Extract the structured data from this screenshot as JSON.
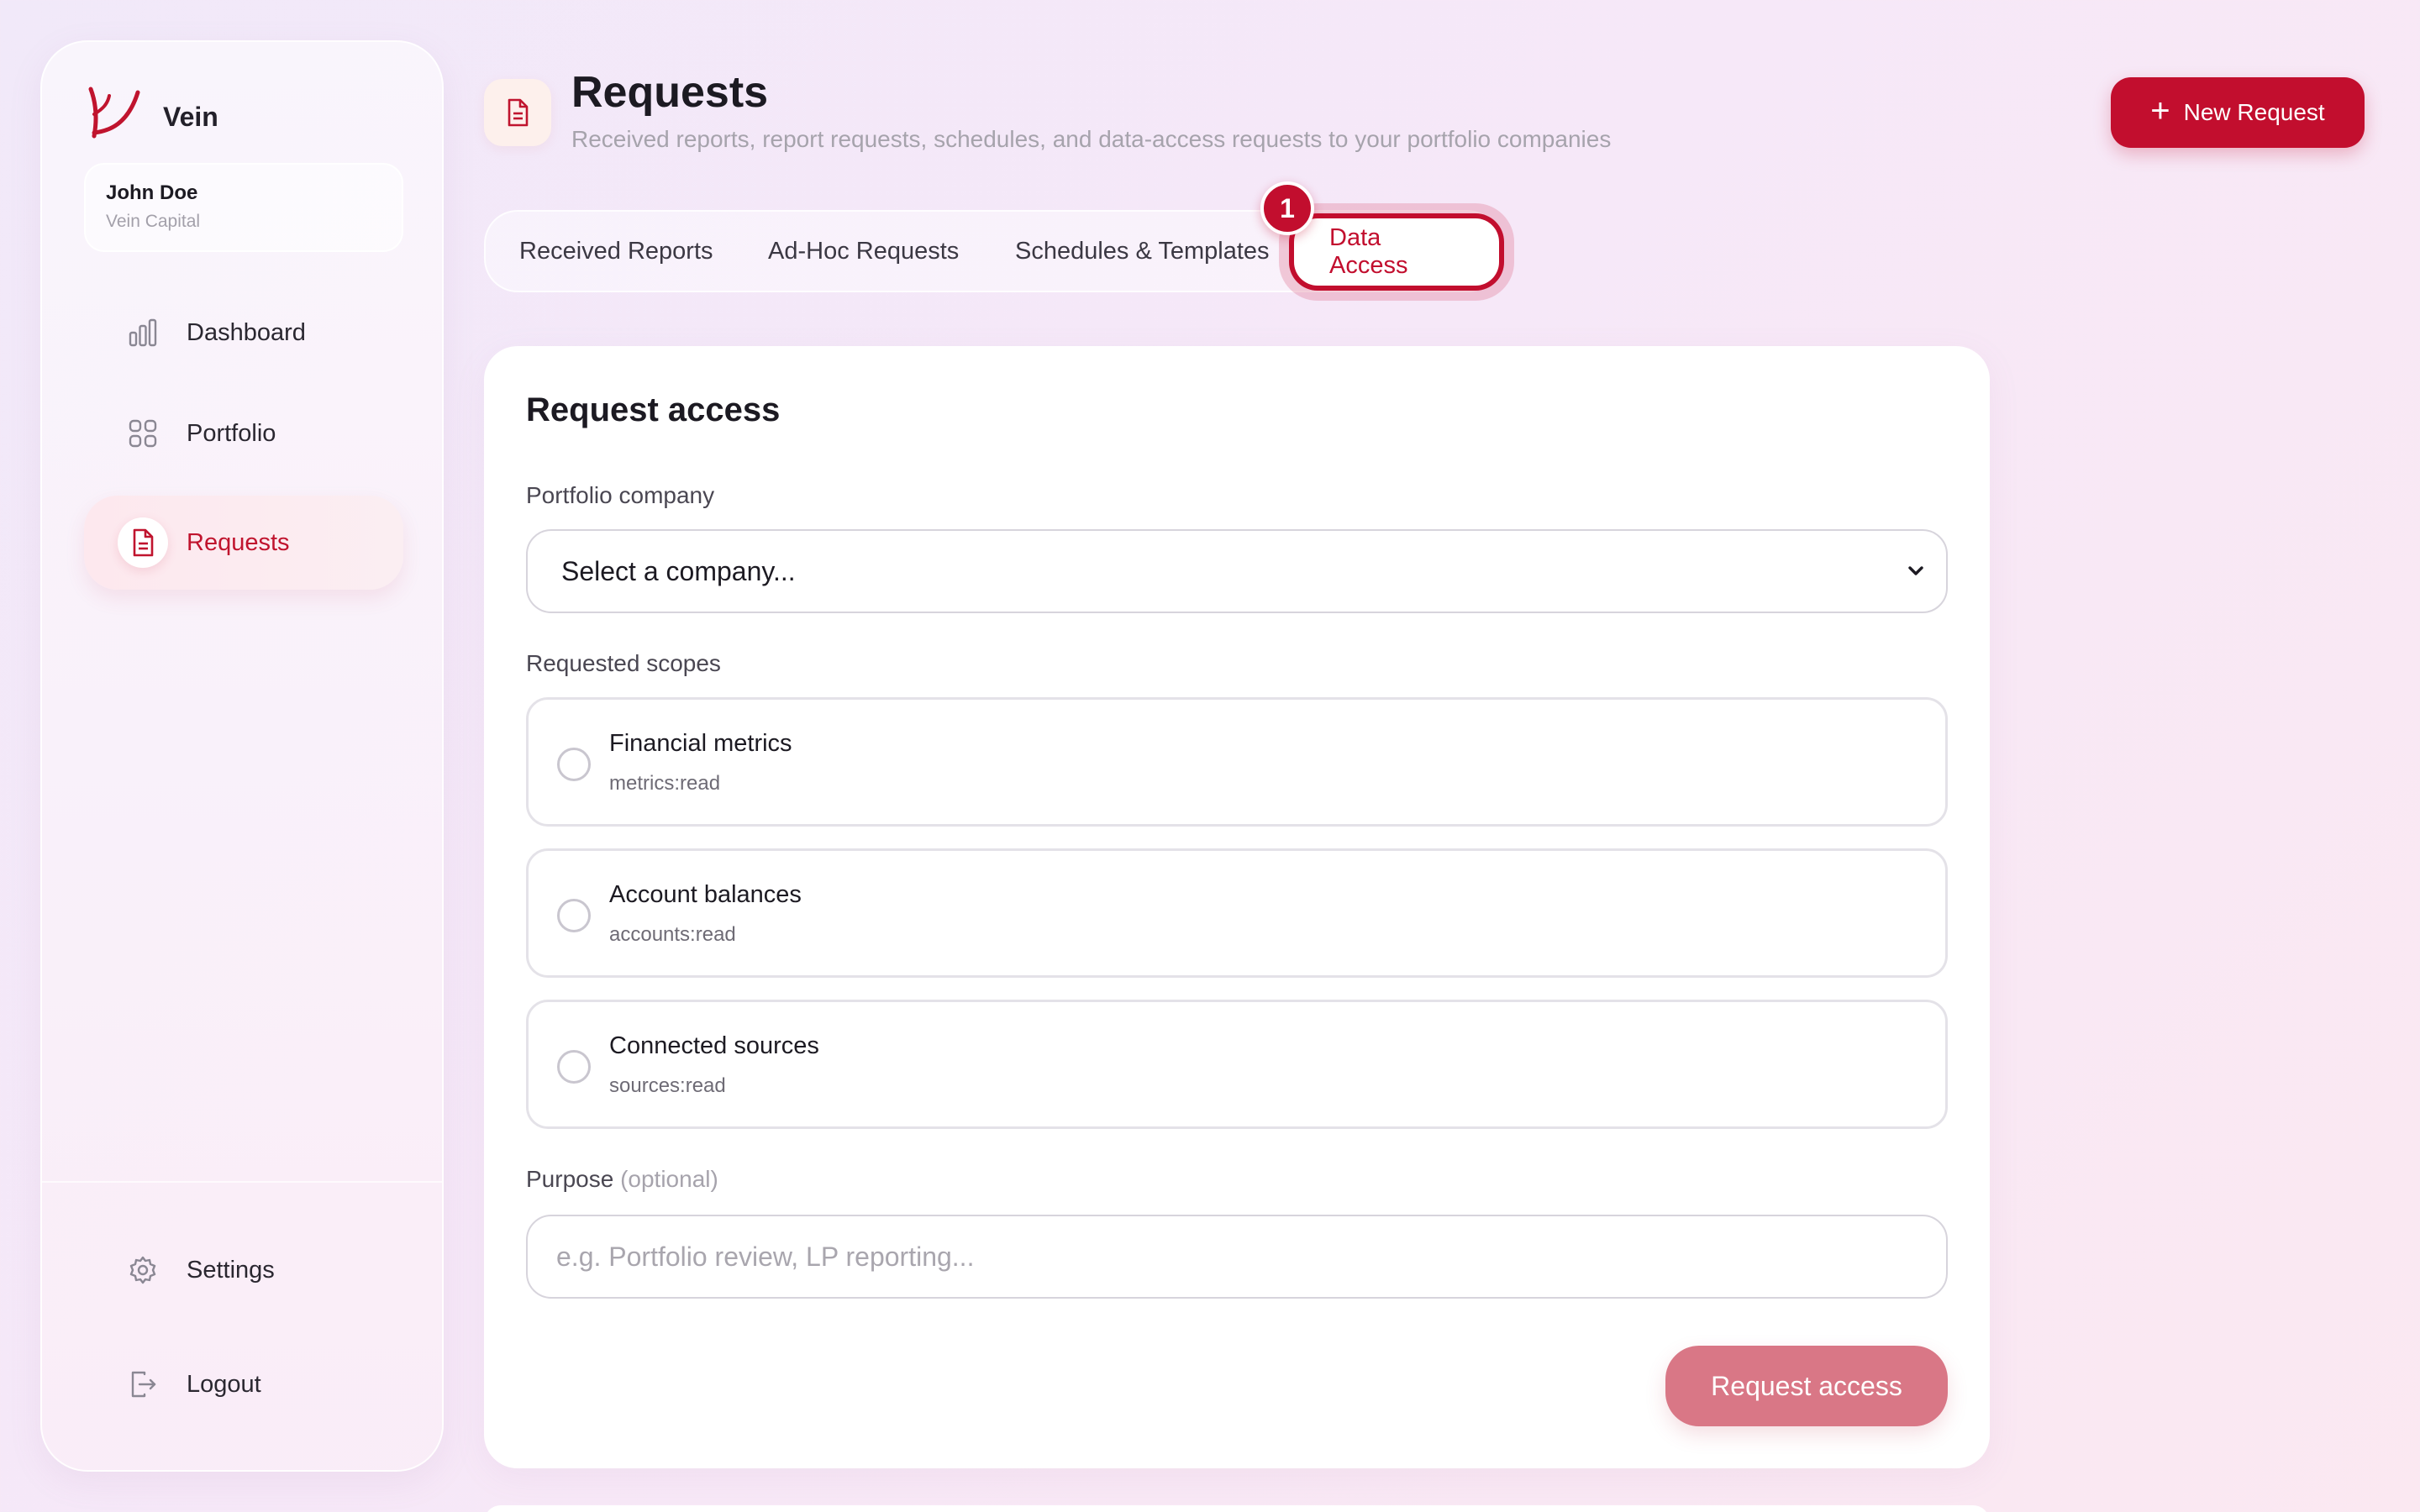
{
  "sidebar": {
    "brand": "Vein",
    "user": {
      "name": "John Doe",
      "org": "Vein Capital"
    },
    "nav": [
      {
        "label": "Dashboard",
        "icon": "bar-chart-icon",
        "active": false
      },
      {
        "label": "Portfolio",
        "icon": "grid-icon",
        "active": false
      },
      {
        "label": "Requests",
        "icon": "document-icon",
        "active": true
      }
    ],
    "footer": [
      {
        "label": "Settings",
        "icon": "gear-icon"
      },
      {
        "label": "Logout",
        "icon": "logout-icon"
      }
    ]
  },
  "header": {
    "title": "Requests",
    "subtitle": "Received reports, report requests, schedules, and data-access requests to your portfolio companies",
    "new_request_label": "New Request"
  },
  "tabs": [
    {
      "label": "Received Reports",
      "active": false
    },
    {
      "label": "Ad-Hoc Requests",
      "active": false
    },
    {
      "label": "Schedules & Templates",
      "active": false
    },
    {
      "label": "Data Access",
      "active": true
    }
  ],
  "annotation_badge": "1",
  "form": {
    "title": "Request access",
    "company_label": "Portfolio company",
    "company_value": "Select a company...",
    "scopes_label": "Requested scopes",
    "scopes": [
      {
        "name": "Financial metrics",
        "code": "metrics:read",
        "checked": false
      },
      {
        "name": "Account balances",
        "code": "accounts:read",
        "checked": false
      },
      {
        "name": "Connected sources",
        "code": "sources:read",
        "checked": false
      }
    ],
    "purpose_label": "Purpose",
    "purpose_optional": "(optional)",
    "purpose_placeholder": "e.g. Portfolio review, LP reporting...",
    "submit_label": "Request access"
  },
  "colors": {
    "accent": "#c20e2e",
    "accent_soft": "#d97786",
    "background": "#f3e9f8"
  }
}
